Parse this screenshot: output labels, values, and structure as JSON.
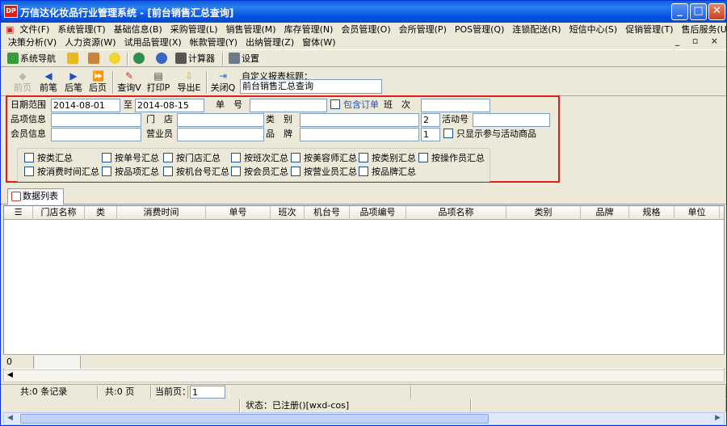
{
  "window": {
    "title": "万信达化妆品行业管理系统 - [前台销售汇总查询]",
    "minimize": "_",
    "maximize": "□",
    "close": "✕"
  },
  "menu_row1": [
    "文件(F)",
    "系统管理(T)",
    "基础信息(B)",
    "采购管理(L)",
    "销售管理(M)",
    "库存管理(N)",
    "会员管理(O)",
    "会所管理(P)",
    "POS管理(Q)",
    "连锁配送(R)",
    "短信中心(S)",
    "促销管理(T)",
    "售后服务(U)"
  ],
  "menu_row2": [
    "决策分析(V)",
    "人力资源(W)",
    "试用品管理(X)",
    "帐款管理(Y)",
    "出纳管理(Z)",
    "窗体(W)"
  ],
  "mdi_controls": "_ ▫ ×",
  "navbar": {
    "system_nav": "系统导航",
    "calculator": "计算器",
    "settings": "设置"
  },
  "toolbar": {
    "first": "前页",
    "prev": "前笔",
    "next": "后笔",
    "last": "后页",
    "query": "查询V",
    "print": "打印P",
    "export": "导出E",
    "close": "关闭Q"
  },
  "report": {
    "title_label": "自定义报表标题：",
    "title_value": "前台销售汇总查询"
  },
  "filters": {
    "date_label": "日期范围",
    "date_from": "2014-08-01",
    "date_to_label": "至",
    "date_to": "2014-08-15",
    "order_no_label": "单　号",
    "order_no": "",
    "include_order": "包含订单",
    "shift_label": "班　次",
    "shift": "",
    "item_label": "品项信息",
    "item": "",
    "store_label": "门　店",
    "store": "",
    "category_label": "类　别",
    "category": "",
    "category_level": "2",
    "activity_label": "活动号",
    "activity": "",
    "member_label": "会员信息",
    "member": "",
    "clerk_label": "营业员",
    "clerk": "",
    "brand_label": "品　牌",
    "brand": "",
    "brand_level": "1",
    "only_activity": "只显示参与活动商品"
  },
  "summary_row1": [
    "按类汇总",
    "按单号汇总",
    "按门店汇总",
    "按班次汇总",
    "按美容师汇总",
    "按类别汇总",
    "按操作员汇总"
  ],
  "summary_row2": [
    "按消费时间汇总",
    "按品项汇总",
    "按机台号汇总",
    "按会员汇总",
    "按营业员汇总",
    "按品牌汇总"
  ],
  "tab": {
    "label": "数据列表"
  },
  "grid": {
    "columns": [
      "门店名称",
      "类",
      "消费时间",
      "单号",
      "班次",
      "机台号",
      "品项编号",
      "品项名称",
      "类别",
      "品牌",
      "规格",
      "单位"
    ]
  },
  "footer": {
    "count": "0"
  },
  "status": {
    "records": "共:0 条记录",
    "pages": "共:0 页",
    "current_label": "当前页：",
    "current_value": "1",
    "reg": "状态：已注册()[wxd-cos]"
  },
  "colors": {
    "title_blue": "#0554e3",
    "highlight_red": "#e31b1b",
    "panel": "#ece9d8"
  }
}
